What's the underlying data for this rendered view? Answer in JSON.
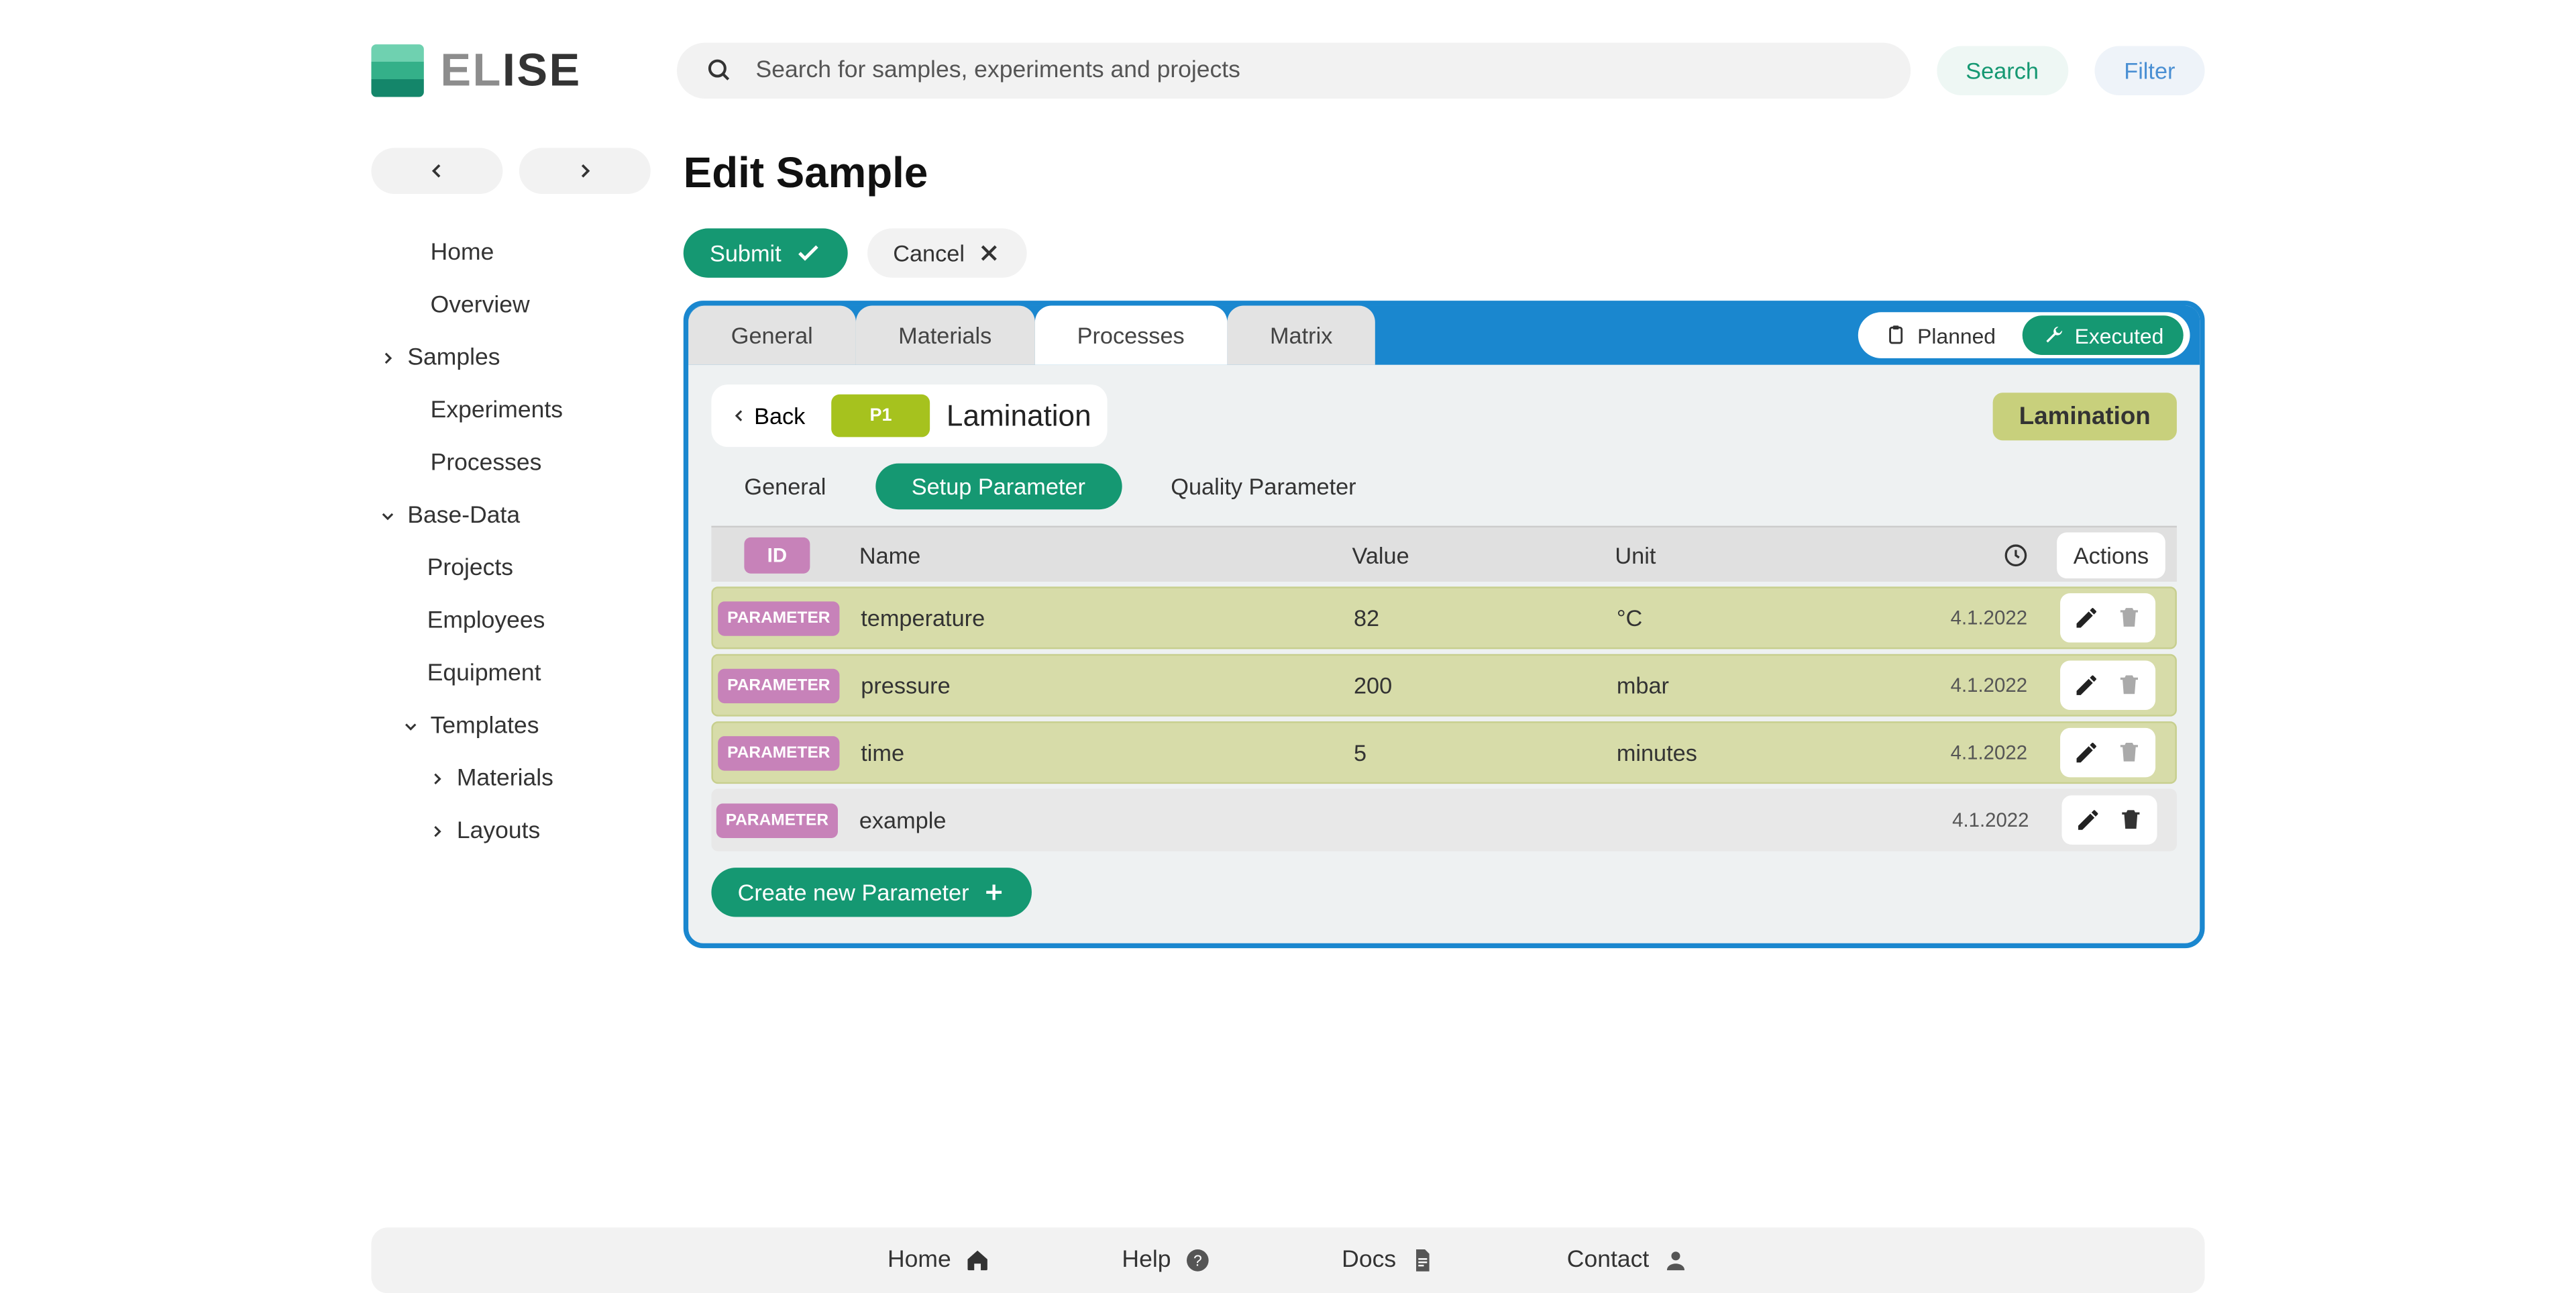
{
  "logo": {
    "part1": "EL",
    "part2": "ISE"
  },
  "search": {
    "placeholder": "Search for samples, experiments and projects",
    "search_btn": "Search",
    "filter_btn": "Filter"
  },
  "sidebar": {
    "items": [
      {
        "label": "Home"
      },
      {
        "label": "Overview"
      },
      {
        "label": "Samples"
      },
      {
        "label": "Experiments"
      },
      {
        "label": "Processes"
      },
      {
        "label": "Base-Data"
      },
      {
        "label": "Projects"
      },
      {
        "label": "Employees"
      },
      {
        "label": "Equipment"
      },
      {
        "label": "Templates"
      },
      {
        "label": "Materials"
      },
      {
        "label": "Layouts"
      }
    ]
  },
  "page": {
    "title": "Edit Sample",
    "submit": "Submit",
    "cancel": "Cancel"
  },
  "tabs": {
    "general": "General",
    "materials": "Materials",
    "processes": "Processes",
    "matrix": "Matrix",
    "planned": "Planned",
    "executed": "Executed"
  },
  "process": {
    "back": "Back",
    "p_badge": "P1",
    "title": "Lamination",
    "chip": "Lamination",
    "subtabs": {
      "general": "General",
      "setup": "Setup Parameter",
      "quality": "Quality Parameter"
    }
  },
  "table": {
    "header": {
      "id": "ID",
      "name": "Name",
      "value": "Value",
      "unit": "Unit",
      "actions": "Actions"
    },
    "badge": "PARAMETER",
    "rows": [
      {
        "name": "temperature",
        "value": "82",
        "unit": "°C",
        "ts": "4.1.2022",
        "exec": true
      },
      {
        "name": "pressure",
        "value": "200",
        "unit": "mbar",
        "ts": "4.1.2022",
        "exec": true
      },
      {
        "name": "time",
        "value": "5",
        "unit": "minutes",
        "ts": "4.1.2022",
        "exec": true
      },
      {
        "name": "example",
        "value": "",
        "unit": "",
        "ts": "4.1.2022",
        "exec": false
      }
    ],
    "create": "Create new Parameter"
  },
  "footer": {
    "home": "Home",
    "help": "Help",
    "docs": "Docs",
    "contact": "Contact"
  }
}
